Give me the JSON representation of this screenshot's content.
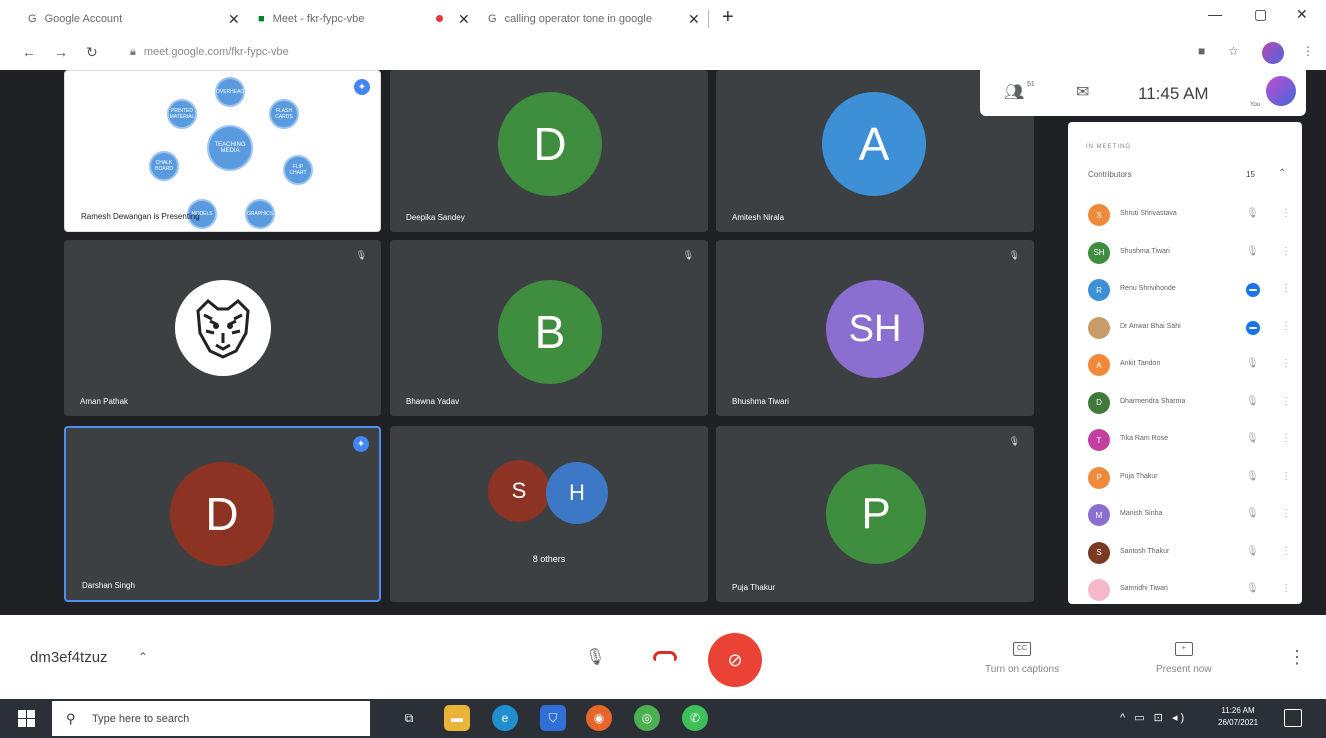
{
  "browser": {
    "tabs": [
      {
        "label": "Google Account",
        "icon": "google-g-icon"
      },
      {
        "label": "Meet - fkr-fypc-vbe",
        "icon": "meet-icon",
        "recording": true
      },
      {
        "label": "calling operator tone in google",
        "icon": "google-g-icon"
      }
    ],
    "url": "meet.google.com/fkr-fypc-vbe"
  },
  "meet_top": {
    "people_count": "51",
    "time": "11:45 AM",
    "you_label": "You"
  },
  "tiles": {
    "presenter": {
      "name": "Ramesh Dewangan is Presenting",
      "center_text": "TEACHING MEDIA",
      "nodes": [
        "OVERHEAD",
        "FLASH CARDS",
        "FLIP CHART",
        "GRAPHICS",
        "MODELS",
        "CHALK BOARD",
        "PRINTED MATERIAL"
      ]
    },
    "deepika": {
      "name": "Deepika Sandey",
      "initial": "D",
      "color": "#3f8e3f"
    },
    "amitesh": {
      "name": "Amitesh Nirala",
      "initial": "A",
      "color": "#3d8fd6"
    },
    "aman": {
      "name": "Aman Pathak"
    },
    "bhawna": {
      "name": "Bhawna Yadav",
      "initial": "B",
      "color": "#3f8e3f"
    },
    "bhushma": {
      "name": "Bhushma Tiwari",
      "initial": "SH",
      "color": "#8a6fd0"
    },
    "darshan": {
      "name": "Darshan Singh",
      "initial": "D",
      "color": "#8c3324"
    },
    "others": {
      "label": "8 others",
      "a": "S",
      "a_color": "#8c3324",
      "b": "H",
      "b_color": "#3d78c6"
    },
    "puja": {
      "name": "Puja Thakur",
      "initial": "P",
      "color": "#3f8e3f"
    }
  },
  "panel": {
    "heading": "IN MEETING",
    "section_label": "Contributors",
    "count": "15",
    "participants": [
      {
        "initial": "S",
        "name": "Shruti Shrivastava",
        "color": "#f08a3a",
        "active": false
      },
      {
        "initial": "SH",
        "name": "Shushma Tiwari",
        "color": "#3f8e3f",
        "active": false
      },
      {
        "initial": "R",
        "name": "Renu Shrivihonde",
        "color": "#3d8fd6",
        "active": true
      },
      {
        "initial": "",
        "name": "Dr Anwar Bhai Sahi",
        "color": "#c89b6a",
        "active": true
      },
      {
        "initial": "A",
        "name": "Ankit Tandon",
        "color": "#f08a3a",
        "active": false
      },
      {
        "initial": "D",
        "name": "Dharmendra Sharma",
        "color": "#3f7a3a",
        "active": false
      },
      {
        "initial": "T",
        "name": "Tika Ram Rose",
        "color": "#c2409f",
        "active": false
      },
      {
        "initial": "P",
        "name": "Puja Thakur",
        "color": "#f08a3a",
        "active": false
      },
      {
        "initial": "M",
        "name": "Manish Sinha",
        "color": "#8a6fd0",
        "active": false
      },
      {
        "initial": "S",
        "name": "Santosh Thakur",
        "color": "#7a3a24",
        "active": false
      },
      {
        "initial": "",
        "name": "Samridhi Tiwari",
        "color": "#f4b8c8",
        "active": false
      }
    ]
  },
  "controls": {
    "meeting_code": "dm3ef4tzuz",
    "captions_label": "Turn on captions",
    "captions_icon": "CC",
    "present_label": "Present now"
  },
  "taskbar": {
    "search_placeholder": "Type here to search",
    "time": "11:26 AM",
    "date": "26/07/2021",
    "apps": [
      {
        "name": "task-view-icon",
        "color": "#2b2f36"
      },
      {
        "name": "file-explorer-icon",
        "color": "#e8b43a"
      },
      {
        "name": "edge-icon",
        "color": "#1f8fcf"
      },
      {
        "name": "defender-icon",
        "color": "#2f6fd6"
      },
      {
        "name": "firefox-icon",
        "color": "#e8662a"
      },
      {
        "name": "chrome-icon",
        "color": "#4caf50"
      },
      {
        "name": "whatsapp-icon",
        "color": "#3fbf5a"
      }
    ]
  }
}
